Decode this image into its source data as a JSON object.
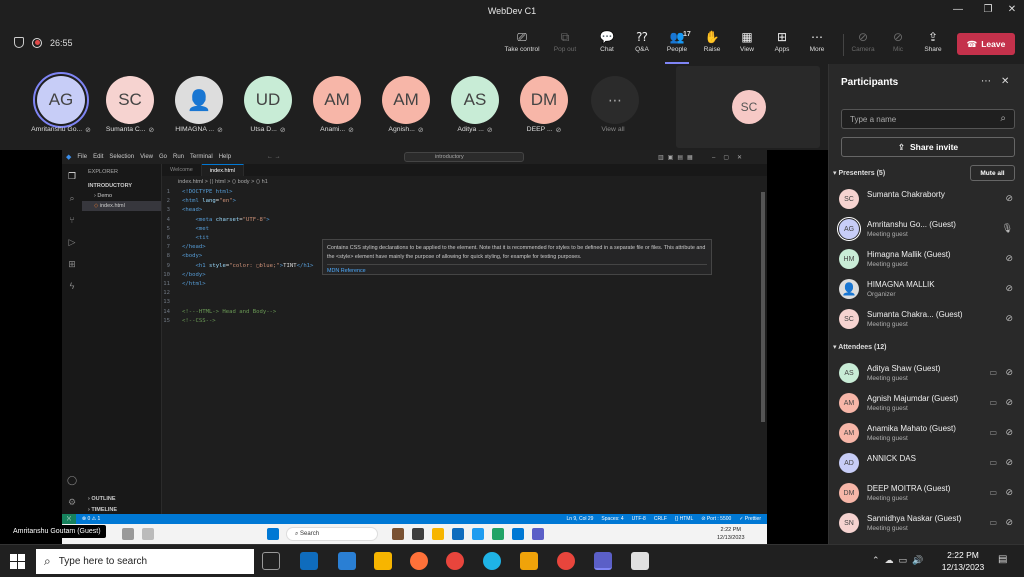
{
  "window": {
    "title": "WebDev C1"
  },
  "meeting": {
    "timer": "26:55",
    "controls": [
      {
        "label": "Take control",
        "icon": "take-control-icon",
        "glyph": "⎚"
      },
      {
        "label": "Pop out",
        "icon": "pop-out-icon",
        "glyph": "⧉",
        "dim": true
      },
      {
        "label": "Chat",
        "icon": "chat-icon",
        "glyph": "💬"
      },
      {
        "label": "Q&A",
        "icon": "qa-icon",
        "glyph": "⁇"
      },
      {
        "label": "People",
        "icon": "people-icon",
        "glyph": "👥",
        "count": "17",
        "active": true
      },
      {
        "label": "Raise",
        "icon": "raise-hand-icon",
        "glyph": "✋"
      },
      {
        "label": "View",
        "icon": "view-icon",
        "glyph": "▦"
      },
      {
        "label": "Apps",
        "icon": "apps-icon",
        "glyph": "⊞"
      },
      {
        "label": "More",
        "icon": "more-icon",
        "glyph": "⋯"
      },
      {
        "label": "Camera",
        "icon": "camera-icon",
        "glyph": "⊘",
        "dim": true
      },
      {
        "label": "Mic",
        "icon": "mic-icon",
        "glyph": "⊘",
        "dim": true
      },
      {
        "label": "Share",
        "icon": "share-icon",
        "glyph": "⇪"
      }
    ],
    "leave_label": "Leave"
  },
  "strip": {
    "participants": [
      {
        "initials": "AG",
        "name": "Amritanshu Go...",
        "color": "#c7cdf7",
        "selected": true
      },
      {
        "initials": "SC",
        "name": "Sumanta C...",
        "color": "#f6d3d0"
      },
      {
        "initials": "",
        "name": "HIMAGNA ...",
        "color": "#dddddd",
        "photo": true
      },
      {
        "initials": "UD",
        "name": "Utsa D...",
        "color": "#c8ecd6"
      },
      {
        "initials": "AM",
        "name": "Anami...",
        "color": "#f7b6a8"
      },
      {
        "initials": "AM",
        "name": "Agnish...",
        "color": "#f7b6a8"
      },
      {
        "initials": "AS",
        "name": "Aditya ...",
        "color": "#c8ecd6"
      },
      {
        "initials": "DM",
        "name": "DEEP ...",
        "color": "#f7b6a8"
      }
    ],
    "view_all": "View all",
    "tile_initials": "SC"
  },
  "vscode": {
    "menu": [
      "File",
      "Edit",
      "Selection",
      "View",
      "Go",
      "Run",
      "Terminal",
      "Help"
    ],
    "search": "introductory",
    "explorer": {
      "title": "EXPLORER",
      "root": "INTRODUCTORY",
      "folder": "Demo",
      "file": "index.html",
      "outline": "OUTLINE",
      "timeline": "TIMELINE"
    },
    "tabs": [
      "Welcome",
      "index.html"
    ],
    "breadcrumb": "index.html > ⟨⟩ html > ⟨⟩ body > ⟨⟩ h1",
    "hover": {
      "text": "Contains CSS styling declarations to be applied to the element. Note that it is recommended for styles to be defined in a separate file or files. This attribute and the <style> element have mainly the purpose of allowing for quick styling, for example for testing purposes.",
      "link": "MDN Reference"
    },
    "status": {
      "left": "⊗ 0 ⚠ 1",
      "right": [
        "Ln 9, Col 29",
        "Spaces: 4",
        "UTF-8",
        "CRLF",
        "{} HTML",
        "⊘ Port : 5500",
        "✓ Prettier"
      ]
    },
    "inner_taskbar": {
      "search": "Search",
      "time": "2:22 PM",
      "date": "12/13/2023"
    }
  },
  "name_badge": "Amritanshu Goutam (Guest)",
  "panel": {
    "title": "Participants",
    "search_placeholder": "Type a name",
    "share_invite": "Share invite",
    "presenters_header": "Presenters (5)",
    "mute_all": "Mute all",
    "attendees_header": "Attendees (12)",
    "presenters": [
      {
        "initials": "SC",
        "name": "Sumanta Chakraborty",
        "role": "",
        "color": "#f6d3d0"
      },
      {
        "initials": "AG",
        "name": "Amritanshu Go...  (Guest)",
        "role": "Meeting guest",
        "color": "#c7cdf7",
        "mic_on": true
      },
      {
        "initials": "HM",
        "name": "Himagna Mallik (Guest)",
        "role": "Meeting guest",
        "color": "#c8ecd6"
      },
      {
        "initials": "",
        "name": "HIMAGNA MALLIK",
        "role": "Organizer",
        "color": "#dddddd",
        "photo": true
      },
      {
        "initials": "SC",
        "name": "Sumanta Chakra...  (Guest)",
        "role": "Meeting guest",
        "color": "#f6d3d0"
      }
    ],
    "attendees": [
      {
        "initials": "AS",
        "name": "Aditya Shaw (Guest)",
        "role": "Meeting guest",
        "color": "#c8ecd6"
      },
      {
        "initials": "AM",
        "name": "Agnish Majumdar (Guest)",
        "role": "Meeting guest",
        "color": "#f7b6a8"
      },
      {
        "initials": "AM",
        "name": "Anamika Mahato (Guest)",
        "role": "Meeting guest",
        "color": "#f7b6a8"
      },
      {
        "initials": "AD",
        "name": "ANNICK DAS",
        "role": "",
        "color": "#c7cdf7"
      },
      {
        "initials": "DM",
        "name": "DEEP MOITRA (Guest)",
        "role": "Meeting guest",
        "color": "#f7b6a8"
      },
      {
        "initials": "SN",
        "name": "Sannidhya Naskar (Guest)",
        "role": "Meeting guest",
        "color": "#f6d3d0"
      }
    ]
  },
  "taskbar": {
    "search": "Type here to search",
    "time": "2:22 PM",
    "date": "12/13/2023"
  }
}
